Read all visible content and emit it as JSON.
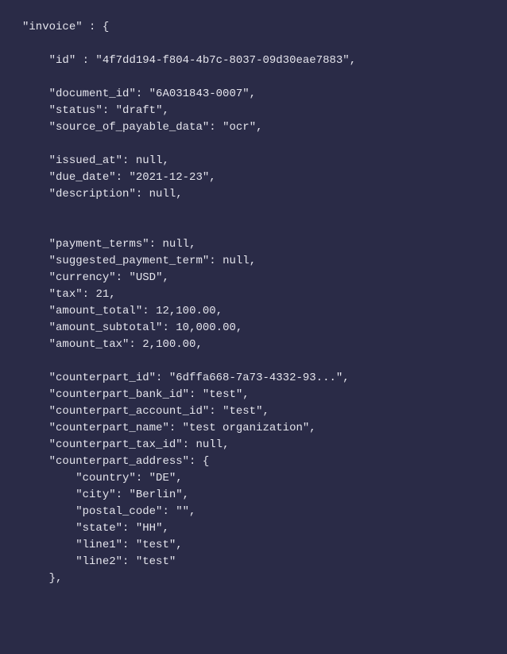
{
  "root_key": "invoice",
  "indent1": "    ",
  "indent2": "        ",
  "fields": {
    "id_key": "id",
    "id_val": "4f7dd194-f804-4b7c-8037-09d30eae7883",
    "document_id_key": "document_id",
    "document_id_val": "6A031843-0007",
    "status_key": "status",
    "status_val": "draft",
    "source_key": "source_of_payable_data",
    "source_val": "ocr",
    "issued_at_key": "issued_at",
    "issued_at_val": "null",
    "due_date_key": "due_date",
    "due_date_val": "2021-12-23",
    "description_key": "description",
    "description_val": "null",
    "payment_terms_key": "payment_terms",
    "payment_terms_val": "null",
    "suggested_payment_term_key": "suggested_payment_term",
    "suggested_payment_term_val": "null",
    "currency_key": "currency",
    "currency_val": "USD",
    "tax_key": "tax",
    "tax_val": "21",
    "amount_total_key": "amount_total",
    "amount_total_val": "12,100.00",
    "amount_subtotal_key": "amount_subtotal",
    "amount_subtotal_val": "10,000.00",
    "amount_tax_key": "amount_tax",
    "amount_tax_val": "2,100.00",
    "counterpart_id_key": "counterpart_id",
    "counterpart_id_val": "6dffa668-7a73-4332-93...",
    "counterpart_bank_id_key": "counterpart_bank_id",
    "counterpart_bank_id_val": "test",
    "counterpart_account_id_key": "counterpart_account_id",
    "counterpart_account_id_val": "test",
    "counterpart_name_key": "counterpart_name",
    "counterpart_name_val": "test organization",
    "counterpart_tax_id_key": "counterpart_tax_id",
    "counterpart_tax_id_val": "null",
    "counterpart_address_key": "counterpart_address",
    "country_key": "country",
    "country_val": "DE",
    "city_key": "city",
    "city_val": "Berlin",
    "postal_code_key": "postal_code",
    "postal_code_val": "",
    "state_key": "state",
    "state_val": "HH",
    "line1_key": "line1",
    "line1_val": "test",
    "line2_key": "line2",
    "line2_val": "test"
  }
}
